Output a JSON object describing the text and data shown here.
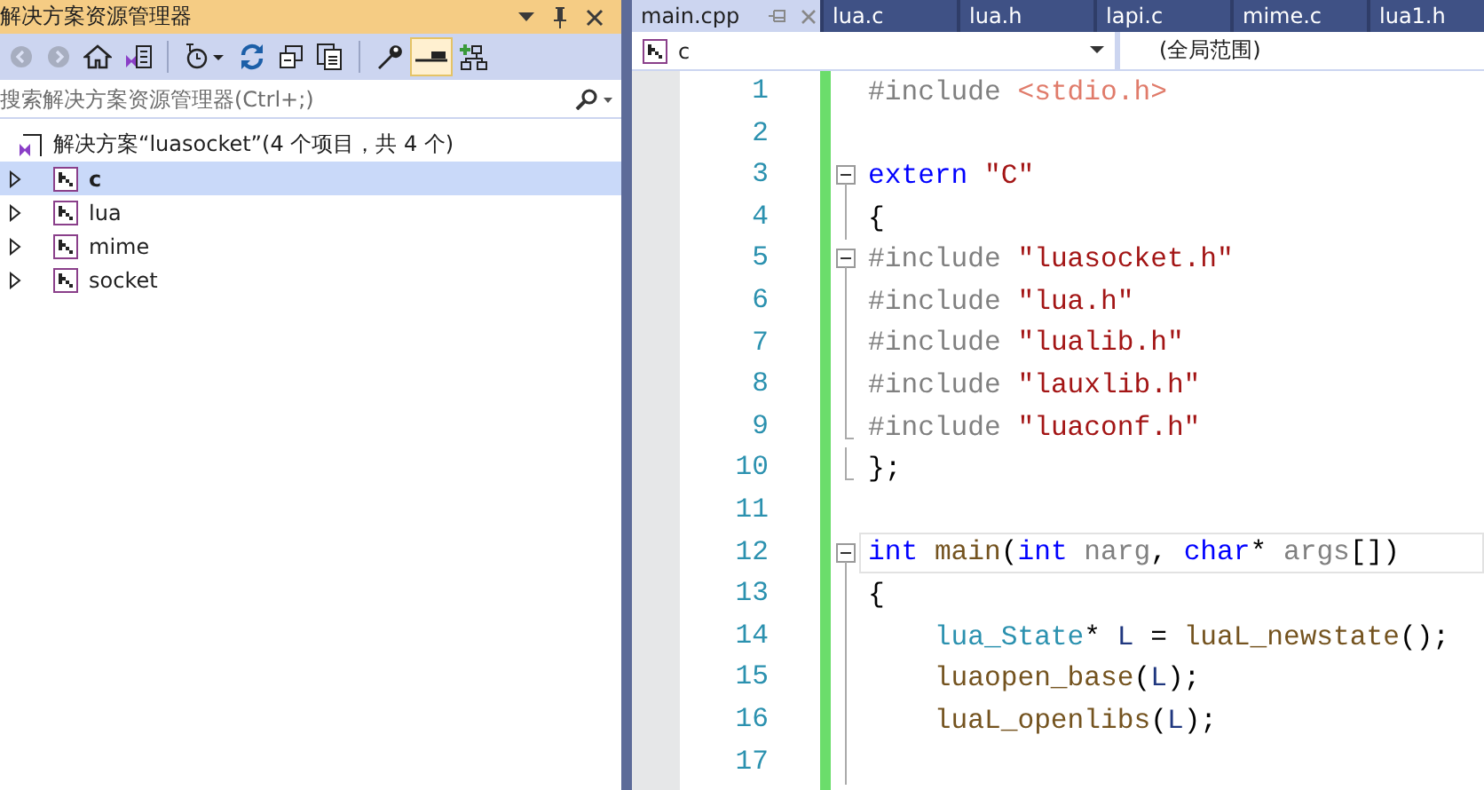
{
  "explorer": {
    "title": "解决方案资源管理器",
    "toolbar": [
      [
        {
          "kind": "back",
          "disabled": true,
          "selected": false
        },
        {
          "kind": "forward",
          "disabled": true,
          "selected": false
        },
        {
          "kind": "home",
          "disabled": false,
          "selected": false
        },
        {
          "kind": "switch-views",
          "disabled": false,
          "selected": false
        }
      ],
      [
        {
          "kind": "history",
          "disabled": false,
          "selected": false
        },
        {
          "kind": "refresh",
          "disabled": false,
          "selected": false
        },
        {
          "kind": "collapse",
          "disabled": false,
          "selected": false
        },
        {
          "kind": "show-all",
          "disabled": false,
          "selected": false
        }
      ],
      [
        {
          "kind": "properties",
          "disabled": false,
          "selected": false
        },
        {
          "kind": "preview",
          "disabled": false,
          "selected": true
        },
        {
          "kind": "diagram",
          "disabled": false,
          "selected": false
        }
      ]
    ],
    "search": {
      "placeholder": "搜索解决方案资源管理器(Ctrl+;)"
    },
    "solution": "解决方案“luasocket”(4 个项目，共 4 个)",
    "projects": [
      {
        "name": "c",
        "selected": true,
        "startup": true,
        "expanded": false
      },
      {
        "name": "lua",
        "selected": false,
        "startup": false,
        "expanded": false
      },
      {
        "name": "mime",
        "selected": false,
        "startup": false,
        "expanded": false
      },
      {
        "name": "socket",
        "selected": false,
        "startup": false,
        "expanded": false
      }
    ]
  },
  "editor": {
    "tabs": [
      {
        "label": "main.cpp",
        "selected": true
      },
      {
        "label": "lua.c",
        "selected": false
      },
      {
        "label": "lua.h",
        "selected": false
      },
      {
        "label": "lapi.c",
        "selected": false
      },
      {
        "label": "mime.c",
        "selected": false
      },
      {
        "label": "lua1.h",
        "selected": false
      }
    ],
    "project_combo": "c",
    "scope_combo": "(全局范围)",
    "lines": [
      {
        "number": "1",
        "kind": "plain",
        "current": false,
        "tokens": [
          {
            "kind": "pre",
            "text": "#include "
          },
          {
            "kind": "inc",
            "text": "<stdio.h>"
          }
        ]
      },
      {
        "number": "2",
        "kind": "plain",
        "current": false
      },
      {
        "number": "3",
        "kind": "fold-start",
        "current": false,
        "tokens": [
          {
            "kind": "kw",
            "text": "extern "
          },
          {
            "kind": "str",
            "text": "\"C\""
          }
        ]
      },
      {
        "number": "4",
        "kind": "fold-mid",
        "current": false,
        "tokens": [
          {
            "kind": "plain",
            "text": "{"
          }
        ]
      },
      {
        "number": "5",
        "kind": "fold-start",
        "current": false,
        "tokens": [
          {
            "kind": "pre",
            "text": "#include "
          },
          {
            "kind": "str",
            "text": "\"luasocket.h\""
          }
        ]
      },
      {
        "number": "6",
        "kind": "fold-mid",
        "current": false,
        "tokens": [
          {
            "kind": "pre",
            "text": "#include "
          },
          {
            "kind": "str",
            "text": "\"lua.h\""
          }
        ]
      },
      {
        "number": "7",
        "kind": "fold-mid",
        "current": false,
        "tokens": [
          {
            "kind": "pre",
            "text": "#include "
          },
          {
            "kind": "str",
            "text": "\"lualib.h\""
          }
        ]
      },
      {
        "number": "8",
        "kind": "fold-mid",
        "current": false,
        "tokens": [
          {
            "kind": "pre",
            "text": "#include "
          },
          {
            "kind": "str",
            "text": "\"lauxlib.h\""
          }
        ]
      },
      {
        "number": "9",
        "kind": "fold-end",
        "current": false,
        "tokens": [
          {
            "kind": "pre",
            "text": "#include "
          },
          {
            "kind": "str",
            "text": "\"luaconf.h\""
          }
        ]
      },
      {
        "number": "10",
        "kind": "fold-end",
        "current": false,
        "tokens": [
          {
            "kind": "plain",
            "text": "};"
          }
        ]
      },
      {
        "number": "11",
        "kind": "plain",
        "current": false
      },
      {
        "number": "12",
        "kind": "fold-start",
        "current": true,
        "tokens": [
          {
            "kind": "kw",
            "text": "int "
          },
          {
            "kind": "fn",
            "text": "main"
          },
          {
            "kind": "plain",
            "text": "("
          },
          {
            "kind": "kw",
            "text": "int "
          },
          {
            "kind": "param",
            "text": "narg"
          },
          {
            "kind": "plain",
            "text": ", "
          },
          {
            "kind": "kw",
            "text": "char"
          },
          {
            "kind": "plain",
            "text": "* "
          },
          {
            "kind": "param",
            "text": "args"
          },
          {
            "kind": "plain",
            "text": "[])"
          }
        ]
      },
      {
        "number": "13",
        "kind": "fold-mid",
        "current": false,
        "tokens": [
          {
            "kind": "plain",
            "text": "{"
          }
        ]
      },
      {
        "number": "14",
        "kind": "fold-mid",
        "current": false,
        "tokens": [
          {
            "kind": "type",
            "text": "    lua_State"
          },
          {
            "kind": "plain",
            "text": "* "
          },
          {
            "kind": "local",
            "text": "L"
          },
          {
            "kind": "plain",
            "text": " = "
          },
          {
            "kind": "fn",
            "text": "luaL_newstate"
          },
          {
            "kind": "plain",
            "text": "();"
          }
        ]
      },
      {
        "number": "15",
        "kind": "fold-mid",
        "current": false,
        "tokens": [
          {
            "kind": "fn",
            "text": "    luaopen_base"
          },
          {
            "kind": "plain",
            "text": "("
          },
          {
            "kind": "local",
            "text": "L"
          },
          {
            "kind": "plain",
            "text": ");"
          }
        ]
      },
      {
        "number": "16",
        "kind": "fold-mid",
        "current": false,
        "tokens": [
          {
            "kind": "fn",
            "text": "    luaL_openlibs"
          },
          {
            "kind": "plain",
            "text": "("
          },
          {
            "kind": "local",
            "text": "L"
          },
          {
            "kind": "plain",
            "text": ");"
          }
        ]
      },
      {
        "number": "17",
        "kind": "fold-mid",
        "current": false
      }
    ]
  }
}
